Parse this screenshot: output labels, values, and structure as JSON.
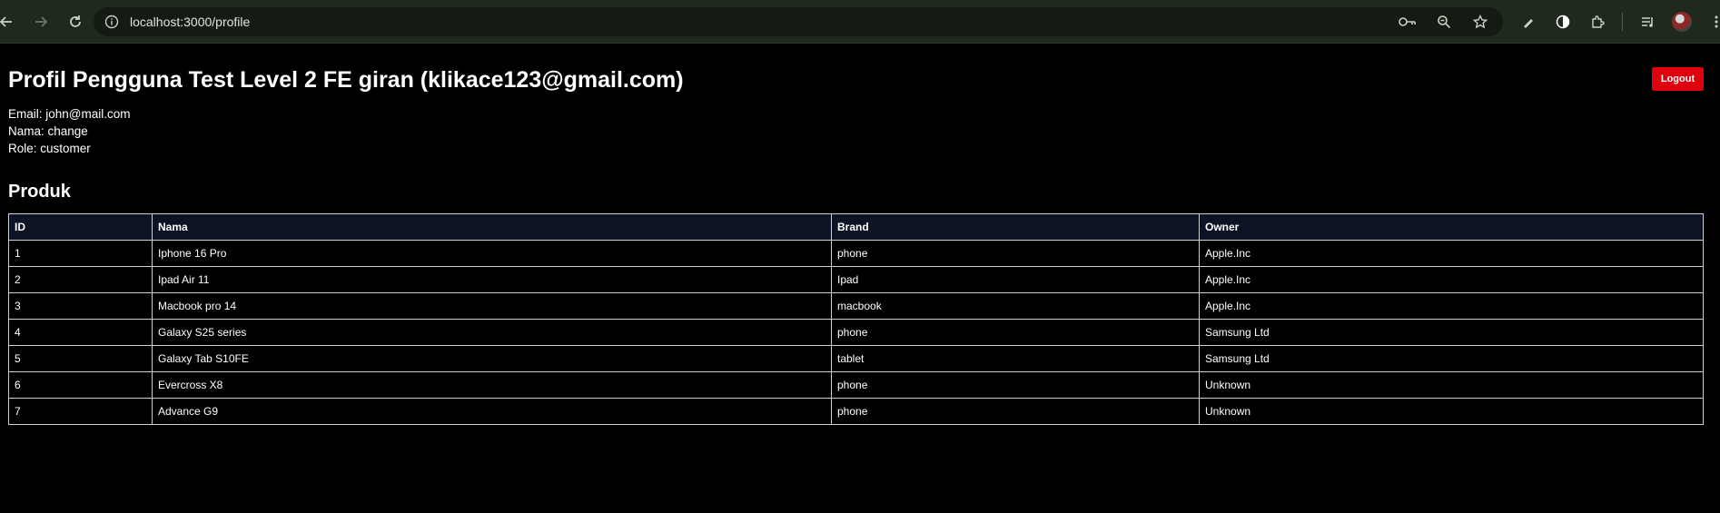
{
  "browser": {
    "url": "localhost:3000/profile",
    "icons": [
      "back-icon",
      "forward-icon",
      "reload-icon",
      "site-info-icon",
      "password-key-icon",
      "zoom-icon",
      "bookmark-star-icon",
      "pen-icon",
      "contrast-icon",
      "extensions-icon",
      "reading-list-icon",
      "profile-avatar"
    ]
  },
  "page": {
    "title": "Profil Pengguna Test Level 2 FE giran (klikace123@gmail.com)",
    "logout_label": "Logout",
    "info": {
      "email": "Email: john@mail.com",
      "nama": "Nama: change",
      "role": "Role: customer"
    },
    "section_title": "Produk"
  },
  "table": {
    "headers": [
      "ID",
      "Nama",
      "Brand",
      "Owner"
    ],
    "rows": [
      [
        "1",
        "Iphone 16 Pro",
        "phone",
        "Apple.Inc"
      ],
      [
        "2",
        "Ipad Air 11",
        "Ipad",
        "Apple.Inc"
      ],
      [
        "3",
        "Macbook pro 14",
        "macbook",
        "Apple.Inc"
      ],
      [
        "4",
        "Galaxy S25 series",
        "phone",
        "Samsung Ltd"
      ],
      [
        "5",
        "Galaxy Tab S10FE",
        "tablet",
        "Samsung Ltd"
      ],
      [
        "6",
        "Evercross X8",
        "phone",
        "Unknown"
      ],
      [
        "7",
        "Advance G9",
        "phone",
        "Unknown"
      ]
    ]
  },
  "colors": {
    "page_bg": "#000000",
    "logout_bg": "#e0000d",
    "header_row_bg": "#0d1324",
    "chrome_bg": "#1f2a1d"
  }
}
